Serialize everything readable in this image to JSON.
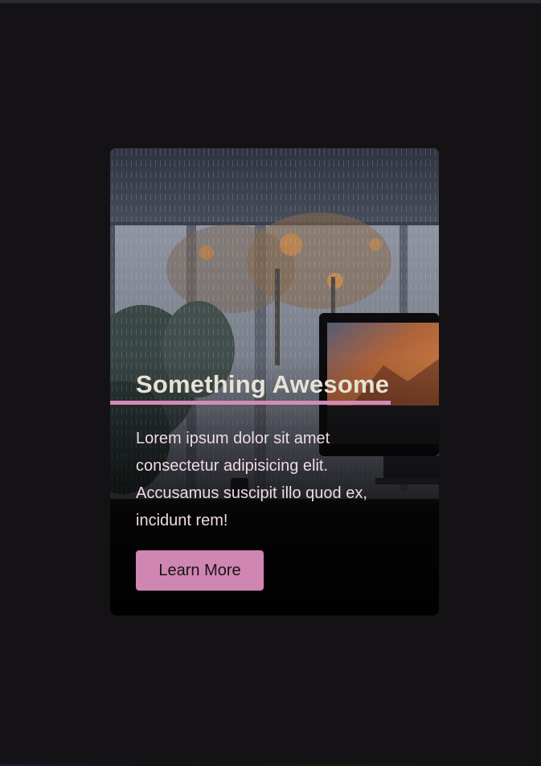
{
  "card": {
    "title": "Something Awesome",
    "body": "Lorem ipsum dolor sit amet consectetur adipisicing elit. Accusamus suscipit illo quod ex, incidunt rem!",
    "button_label": "Learn More",
    "background_image": "rainy-window-desk-computer"
  },
  "colors": {
    "page_background": "#141215",
    "accent": "#d38ab7",
    "button_background": "#cf86b2",
    "title_text": "#e6e2d6",
    "body_text": "#efd9e6"
  }
}
